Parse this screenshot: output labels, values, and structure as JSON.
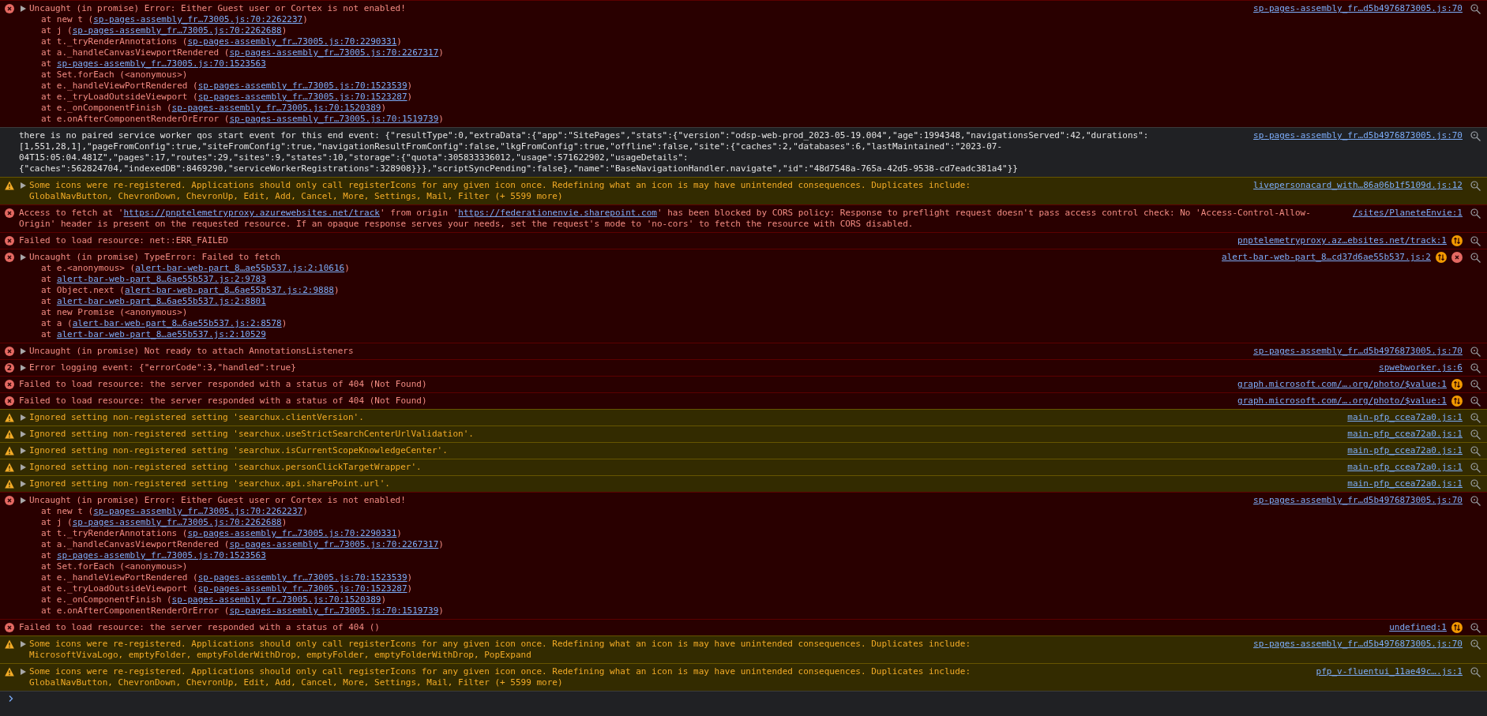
{
  "entries": [
    {
      "kind": "error",
      "expandable": true,
      "message": [
        {
          "kind": "text",
          "text": "Uncaught (in promise) Error: Either Guest user or Cortex is not enabled!"
        }
      ],
      "stack": [
        {
          "parts": [
            {
              "kind": "text",
              "text": "at new t ("
            },
            {
              "kind": "link",
              "text": "sp-pages-assembly_fr…73005.js:70:2262237"
            },
            {
              "kind": "text",
              "text": ")"
            }
          ]
        },
        {
          "parts": [
            {
              "kind": "text",
              "text": "at j ("
            },
            {
              "kind": "link",
              "text": "sp-pages-assembly_fr…73005.js:70:2262688"
            },
            {
              "kind": "text",
              "text": ")"
            }
          ]
        },
        {
          "parts": [
            {
              "kind": "text",
              "text": "at t._tryRenderAnnotations ("
            },
            {
              "kind": "link",
              "text": "sp-pages-assembly_fr…73005.js:70:2290331"
            },
            {
              "kind": "text",
              "text": ")"
            }
          ]
        },
        {
          "parts": [
            {
              "kind": "text",
              "text": "at a._handleCanvasViewportRendered ("
            },
            {
              "kind": "link",
              "text": "sp-pages-assembly_fr…73005.js:70:2267317"
            },
            {
              "kind": "text",
              "text": ")"
            }
          ]
        },
        {
          "parts": [
            {
              "kind": "text",
              "text": "at "
            },
            {
              "kind": "link",
              "text": "sp-pages-assembly_fr…73005.js:70:1523563"
            }
          ]
        },
        {
          "parts": [
            {
              "kind": "text",
              "text": "at Set.forEach (<anonymous>)"
            }
          ]
        },
        {
          "parts": [
            {
              "kind": "text",
              "text": "at e._handleViewPortRendered ("
            },
            {
              "kind": "link",
              "text": "sp-pages-assembly_fr…73005.js:70:1523539"
            },
            {
              "kind": "text",
              "text": ")"
            }
          ]
        },
        {
          "parts": [
            {
              "kind": "text",
              "text": "at e._tryLoadOutsideViewport ("
            },
            {
              "kind": "link",
              "text": "sp-pages-assembly_fr…73005.js:70:1523287"
            },
            {
              "kind": "text",
              "text": ")"
            }
          ]
        },
        {
          "parts": [
            {
              "kind": "text",
              "text": "at e._onComponentFinish ("
            },
            {
              "kind": "link",
              "text": "sp-pages-assembly_fr…73005.js:70:1520389"
            },
            {
              "kind": "text",
              "text": ")"
            }
          ]
        },
        {
          "parts": [
            {
              "kind": "text",
              "text": "at e.onAfterComponentRenderOrError ("
            },
            {
              "kind": "link",
              "text": "sp-pages-assembly_fr…73005.js:70:1519739"
            },
            {
              "kind": "text",
              "text": ")"
            }
          ]
        }
      ],
      "source": "sp-pages-assembly_fr…d5b4976873005.js:70"
    },
    {
      "kind": "info",
      "message": [
        {
          "kind": "text",
          "text": "there is no paired service worker qos start event for this end event: {\"resultType\":0,\"extraData\":{\"app\":\"SitePages\",\"stats\":{\"version\":\"odsp-web-prod_2023-05-19.004\",\"age\":1994348,\"navigationsServed\":42,\"durations\":[1,551,28,1],\"pageFromConfig\":true,\"siteFromConfig\":true,\"navigationResultFromConfig\":false,\"lkgFromConfig\":true,\"offline\":false,\"site\":{\"caches\":2,\"databases\":6,\"lastMaintained\":\"2023-07-04T15:05:04.481Z\",\"pages\":17,\"routes\":29,\"sites\":9,\"states\":10,\"storage\":{\"quota\":305833336012,\"usage\":571622902,\"usageDetails\":{\"caches\":562824704,\"indexedDB\":8469290,\"serviceWorkerRegistrations\":328908}}},\"scriptSyncPending\":false},\"name\":\"BaseNavigationHandler.navigate\",\"id\":\"48d7548a-765a-42d5-9538-cd7eadc381a4\"}}"
        }
      ],
      "source": "sp-pages-assembly_fr…d5b4976873005.js:70"
    },
    {
      "kind": "warning",
      "expandable": true,
      "message": [
        {
          "kind": "text",
          "text": "Some icons were re-registered. Applications should only call registerIcons for any given icon once. Redefining what an icon is may have unintended consequences. Duplicates include:\nGlobalNavButton, ChevronDown, ChevronUp, Edit, Add, Cancel, More, Settings, Mail, Filter (+ 5599 more)"
        }
      ],
      "source": "livepersonacard_with…86a06b1f5109d.js:12"
    },
    {
      "kind": "error",
      "message": [
        {
          "kind": "text",
          "text": "Access to fetch at '"
        },
        {
          "kind": "link",
          "text": "https://pnptelemetryproxy.azurewebsites.net/track"
        },
        {
          "kind": "text",
          "text": "' from origin '"
        },
        {
          "kind": "link",
          "text": "https://federationenvie.sharepoint.com"
        },
        {
          "kind": "text",
          "text": "' has been blocked by CORS policy: Response to preflight request doesn't pass access control check: No 'Access-Control-Allow-Origin' header is present on the requested resource. If an opaque response serves your needs, set the request's mode to 'no-cors' to fetch the resource with CORS disabled."
        }
      ],
      "source": "/sites/PlaneteEnvie:1"
    },
    {
      "kind": "error",
      "network": true,
      "message": [
        {
          "kind": "text",
          "text": "Failed to load resource: net::ERR_FAILED"
        }
      ],
      "source": "pnptelemetryproxy.az…ebsites.net/track:1"
    },
    {
      "kind": "error",
      "expandable": true,
      "network": true,
      "blocked": true,
      "message": [
        {
          "kind": "text",
          "text": "Uncaught (in promise) TypeError: Failed to fetch"
        }
      ],
      "stack": [
        {
          "parts": [
            {
              "kind": "text",
              "text": "at e.<anonymous> ("
            },
            {
              "kind": "link",
              "text": "alert-bar-web-part_8…ae55b537.js:2:10616"
            },
            {
              "kind": "text",
              "text": ")"
            }
          ]
        },
        {
          "parts": [
            {
              "kind": "text",
              "text": "at "
            },
            {
              "kind": "link",
              "text": "alert-bar-web-part_8…6ae55b537.js:2:9783"
            }
          ]
        },
        {
          "parts": [
            {
              "kind": "text",
              "text": "at Object.next ("
            },
            {
              "kind": "link",
              "text": "alert-bar-web-part_8…6ae55b537.js:2:9888"
            },
            {
              "kind": "text",
              "text": ")"
            }
          ]
        },
        {
          "parts": [
            {
              "kind": "text",
              "text": "at "
            },
            {
              "kind": "link",
              "text": "alert-bar-web-part_8…6ae55b537.js:2:8801"
            }
          ]
        },
        {
          "parts": [
            {
              "kind": "text",
              "text": "at new Promise (<anonymous>)"
            }
          ]
        },
        {
          "parts": [
            {
              "kind": "text",
              "text": "at a ("
            },
            {
              "kind": "link",
              "text": "alert-bar-web-part_8…6ae55b537.js:2:8578"
            },
            {
              "kind": "text",
              "text": ")"
            }
          ]
        },
        {
          "parts": [
            {
              "kind": "text",
              "text": "at "
            },
            {
              "kind": "link",
              "text": "alert-bar-web-part_8…ae55b537.js:2:10529"
            }
          ]
        }
      ],
      "source": "alert-bar-web-part_8…cd37d6ae55b537.js:2"
    },
    {
      "kind": "error",
      "expandable": true,
      "message": [
        {
          "kind": "text",
          "text": "Uncaught (in promise) Not ready to attach AnnotationsListeners"
        }
      ],
      "source": "sp-pages-assembly_fr…d5b4976873005.js:70"
    },
    {
      "kind": "error",
      "count": "2",
      "expandable": true,
      "message": [
        {
          "kind": "text",
          "text": "Error logging event: {\"errorCode\":3,\"handled\":true}"
        }
      ],
      "source": "spwebworker.js:6"
    },
    {
      "kind": "error",
      "network": true,
      "message": [
        {
          "kind": "text",
          "text": "Failed to load resource: the server responded with a status of 404 (Not Found)"
        }
      ],
      "source": "graph.microsoft.com/….org/photo/$value:1"
    },
    {
      "kind": "error",
      "network": true,
      "message": [
        {
          "kind": "text",
          "text": "Failed to load resource: the server responded with a status of 404 (Not Found)"
        }
      ],
      "source": "graph.microsoft.com/….org/photo/$value:1"
    },
    {
      "kind": "warning",
      "expandable": true,
      "message": [
        {
          "kind": "text",
          "text": "Ignored setting non-registered setting 'searchux.clientVersion'."
        }
      ],
      "source": "main-pfp_ccea72a0.js:1"
    },
    {
      "kind": "warning",
      "expandable": true,
      "message": [
        {
          "kind": "text",
          "text": "Ignored setting non-registered setting 'searchux.useStrictSearchCenterUrlValidation'."
        }
      ],
      "source": "main-pfp_ccea72a0.js:1"
    },
    {
      "kind": "warning",
      "expandable": true,
      "message": [
        {
          "kind": "text",
          "text": "Ignored setting non-registered setting 'searchux.isCurrentScopeKnowledgeCenter'."
        }
      ],
      "source": "main-pfp_ccea72a0.js:1"
    },
    {
      "kind": "warning",
      "expandable": true,
      "message": [
        {
          "kind": "text",
          "text": "Ignored setting non-registered setting 'searchux.personClickTargetWrapper'."
        }
      ],
      "source": "main-pfp_ccea72a0.js:1"
    },
    {
      "kind": "warning",
      "expandable": true,
      "message": [
        {
          "kind": "text",
          "text": "Ignored setting non-registered setting 'searchux.api.sharePoint.url'."
        }
      ],
      "source": "main-pfp_ccea72a0.js:1"
    },
    {
      "kind": "error",
      "expandable": true,
      "message": [
        {
          "kind": "text",
          "text": "Uncaught (in promise) Error: Either Guest user or Cortex is not enabled!"
        }
      ],
      "stack": [
        {
          "parts": [
            {
              "kind": "text",
              "text": "at new t ("
            },
            {
              "kind": "link",
              "text": "sp-pages-assembly_fr…73005.js:70:2262237"
            },
            {
              "kind": "text",
              "text": ")"
            }
          ]
        },
        {
          "parts": [
            {
              "kind": "text",
              "text": "at j ("
            },
            {
              "kind": "link",
              "text": "sp-pages-assembly_fr…73005.js:70:2262688"
            },
            {
              "kind": "text",
              "text": ")"
            }
          ]
        },
        {
          "parts": [
            {
              "kind": "text",
              "text": "at t._tryRenderAnnotations ("
            },
            {
              "kind": "link",
              "text": "sp-pages-assembly_fr…73005.js:70:2290331"
            },
            {
              "kind": "text",
              "text": ")"
            }
          ]
        },
        {
          "parts": [
            {
              "kind": "text",
              "text": "at a._handleCanvasViewportRendered ("
            },
            {
              "kind": "link",
              "text": "sp-pages-assembly_fr…73005.js:70:2267317"
            },
            {
              "kind": "text",
              "text": ")"
            }
          ]
        },
        {
          "parts": [
            {
              "kind": "text",
              "text": "at "
            },
            {
              "kind": "link",
              "text": "sp-pages-assembly_fr…73005.js:70:1523563"
            }
          ]
        },
        {
          "parts": [
            {
              "kind": "text",
              "text": "at Set.forEach (<anonymous>)"
            }
          ]
        },
        {
          "parts": [
            {
              "kind": "text",
              "text": "at e._handleViewPortRendered ("
            },
            {
              "kind": "link",
              "text": "sp-pages-assembly_fr…73005.js:70:1523539"
            },
            {
              "kind": "text",
              "text": ")"
            }
          ]
        },
        {
          "parts": [
            {
              "kind": "text",
              "text": "at e._tryLoadOutsideViewport ("
            },
            {
              "kind": "link",
              "text": "sp-pages-assembly_fr…73005.js:70:1523287"
            },
            {
              "kind": "text",
              "text": ")"
            }
          ]
        },
        {
          "parts": [
            {
              "kind": "text",
              "text": "at e._onComponentFinish ("
            },
            {
              "kind": "link",
              "text": "sp-pages-assembly_fr…73005.js:70:1520389"
            },
            {
              "kind": "text",
              "text": ")"
            }
          ]
        },
        {
          "parts": [
            {
              "kind": "text",
              "text": "at e.onAfterComponentRenderOrError ("
            },
            {
              "kind": "link",
              "text": "sp-pages-assembly_fr…73005.js:70:1519739"
            },
            {
              "kind": "text",
              "text": ")"
            }
          ]
        }
      ],
      "source": "sp-pages-assembly_fr…d5b4976873005.js:70"
    },
    {
      "kind": "error",
      "network": true,
      "message": [
        {
          "kind": "text",
          "text": "Failed to load resource: the server responded with a status of 404 ()"
        }
      ],
      "source": "undefined:1"
    },
    {
      "kind": "warning",
      "expandable": true,
      "message": [
        {
          "kind": "text",
          "text": "Some icons were re-registered. Applications should only call registerIcons for any given icon once. Redefining what an icon is may have unintended consequences. Duplicates include:\nMicrosoftVivaLogo, emptyFolder, emptyFolderWithDrop, emptyFolder, emptyFolderWithDrop, PopExpand"
        }
      ],
      "source": "sp-pages-assembly_fr…d5b4976873005.js:70"
    },
    {
      "kind": "warning",
      "expandable": true,
      "message": [
        {
          "kind": "text",
          "text": "Some icons were re-registered. Applications should only call registerIcons for any given icon once. Redefining what an icon is may have unintended consequences. Duplicates include:\nGlobalNavButton, ChevronDown, ChevronUp, Edit, Add, Cancel, More, Settings, Mail, Filter (+ 5599 more)"
        }
      ],
      "source": "pfp_v-fluentui_11ae49c….js:1"
    }
  ]
}
